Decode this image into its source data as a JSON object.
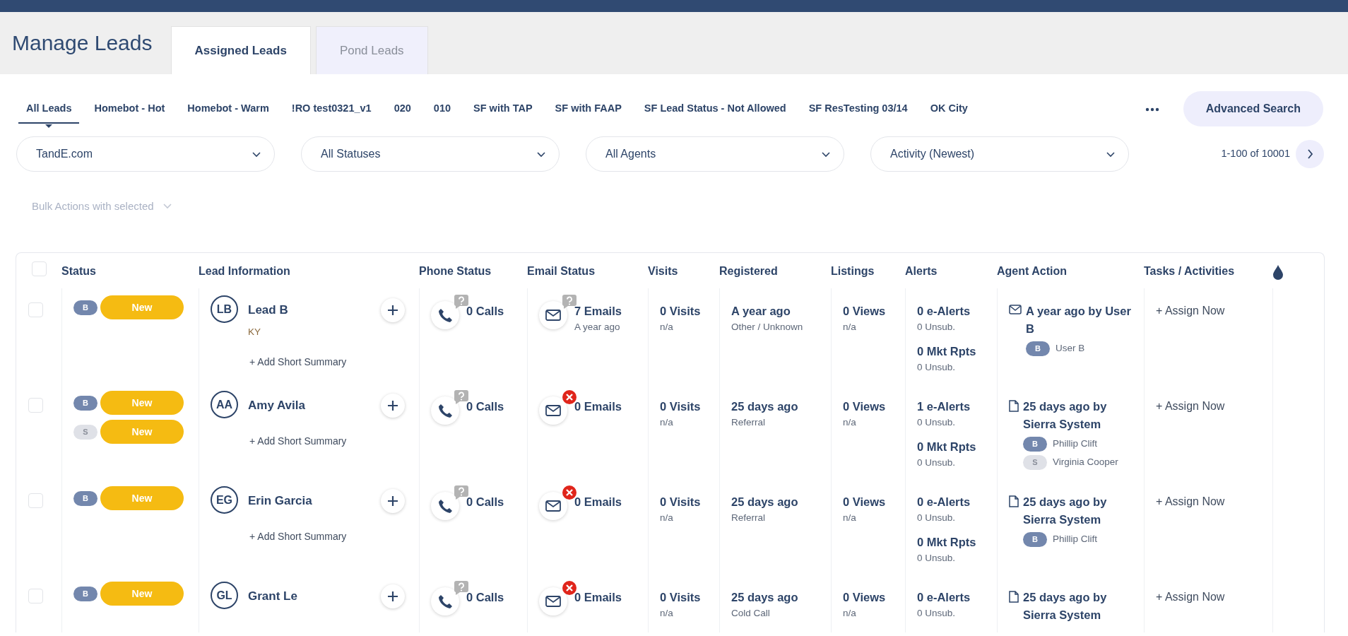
{
  "header": {
    "title": "Manage Leads",
    "tabs": [
      {
        "label": "Assigned Leads",
        "selected": true
      },
      {
        "label": "Pond Leads",
        "selected": false
      }
    ]
  },
  "saved_searches": [
    {
      "label": "All Leads",
      "selected": true
    },
    {
      "label": "Homebot - Hot",
      "selected": false
    },
    {
      "label": "Homebot - Warm",
      "selected": false
    },
    {
      "label": "!RO test0321_v1",
      "selected": false
    },
    {
      "label": "020",
      "selected": false
    },
    {
      "label": "010",
      "selected": false
    },
    {
      "label": "SF with TAP",
      "selected": false
    },
    {
      "label": "SF with FAAP",
      "selected": false
    },
    {
      "label": "SF Lead Status - Not Allowed",
      "selected": false
    },
    {
      "label": "SF ResTesting 03/14",
      "selected": false
    },
    {
      "label": "OK City",
      "selected": false
    }
  ],
  "advanced_search_button": "Advanced Search",
  "filters": [
    {
      "value": "TandE.com"
    },
    {
      "value": "All Statuses"
    },
    {
      "value": "All Agents"
    },
    {
      "value": "Activity (Newest)"
    }
  ],
  "pagination": "1-100 of 10001",
  "bulk_actions": {
    "label": "Bulk Actions with selected",
    "disabled": true
  },
  "table": {
    "select_all": {
      "checked": false
    },
    "columns": [
      "Status",
      "Lead Information",
      "Phone Status",
      "Email Status",
      "Visits",
      "Registered",
      "Listings",
      "Alerts",
      "Agent Action",
      "Tasks / Activities"
    ],
    "rows": [
      {
        "selected": false,
        "statuses": [
          {
            "initial": "B",
            "color": "#7387ad",
            "label": "New"
          }
        ],
        "initials": "LB",
        "name": "Lead B",
        "location": "KY",
        "summary": "+ Add Short Summary",
        "calls": "0 Calls",
        "phone_unknown": true,
        "emails": "7 Emails",
        "email_time": "A year ago",
        "email_unknown": true,
        "visits": "0 Visits",
        "visits_detail": "n/a",
        "registered": "A year ago",
        "source": "Other / Unknown",
        "views": "0 Views",
        "views_detail": "n/a",
        "alerts": [
          {
            "count": "0 e-Alerts",
            "unsub": "0 Unsub."
          },
          {
            "count": "0 Mkt Rpts",
            "unsub": "0 Unsub."
          }
        ],
        "action": {
          "kind": "email",
          "text": "A year ago by User B",
          "agents": [
            {
              "initial": "B",
              "color": "#7387ad",
              "name": "User B"
            }
          ]
        },
        "task": "+ Assign Now"
      },
      {
        "selected": false,
        "statuses": [
          {
            "initial": "B",
            "color": "#7387ad",
            "label": "New"
          },
          {
            "initial": "S",
            "color": "#dfe1e7",
            "label": "New"
          }
        ],
        "initials": "AA",
        "name": "Amy Avila",
        "summary": "+ Add Short Summary",
        "calls": "0 Calls",
        "phone_unknown": true,
        "emails": "0 Emails",
        "email_error": true,
        "visits": "0 Visits",
        "visits_detail": "n/a",
        "registered": "25 days ago",
        "source": "Referral",
        "views": "0 Views",
        "views_detail": "n/a",
        "alerts": [
          {
            "count": "1 e-Alerts",
            "unsub": "0 Unsub."
          },
          {
            "count": "0 Mkt Rpts",
            "unsub": "0 Unsub."
          }
        ],
        "action": {
          "kind": "note",
          "text": "25 days ago by Sierra System",
          "agents": [
            {
              "initial": "B",
              "color": "#7387ad",
              "name": "Phillip Clift"
            },
            {
              "initial": "S",
              "color": "#dfe1e7",
              "name": "Virginia Cooper"
            }
          ]
        },
        "task": "+ Assign Now"
      },
      {
        "selected": false,
        "statuses": [
          {
            "initial": "B",
            "color": "#7387ad",
            "label": "New"
          }
        ],
        "initials": "EG",
        "name": "Erin Garcia",
        "summary": "+ Add Short Summary",
        "calls": "0 Calls",
        "phone_unknown": true,
        "emails": "0 Emails",
        "email_error": true,
        "visits": "0 Visits",
        "visits_detail": "n/a",
        "registered": "25 days ago",
        "source": "Referral",
        "views": "0 Views",
        "views_detail": "n/a",
        "alerts": [
          {
            "count": "0 e-Alerts",
            "unsub": "0 Unsub."
          },
          {
            "count": "0 Mkt Rpts",
            "unsub": "0 Unsub."
          }
        ],
        "action": {
          "kind": "note",
          "text": "25 days ago by Sierra System",
          "agents": [
            {
              "initial": "B",
              "color": "#7387ad",
              "name": "Phillip Clift"
            }
          ]
        },
        "task": "+ Assign Now"
      },
      {
        "selected": false,
        "statuses": [
          {
            "initial": "B",
            "color": "#7387ad",
            "label": "New"
          }
        ],
        "initials": "GL",
        "name": "Grant Le",
        "calls": "0 Calls",
        "phone_unknown": true,
        "emails": "0 Emails",
        "email_error": true,
        "visits": "0 Visits",
        "visits_detail": "n/a",
        "registered": "25 days ago",
        "source": "Cold Call",
        "views": "0 Views",
        "views_detail": "n/a",
        "alerts": [
          {
            "count": "0 e-Alerts",
            "unsub": "0 Unsub."
          }
        ],
        "action": {
          "kind": "note",
          "text": "25 days ago by Sierra System"
        },
        "task": "+ Assign Now"
      }
    ]
  }
}
